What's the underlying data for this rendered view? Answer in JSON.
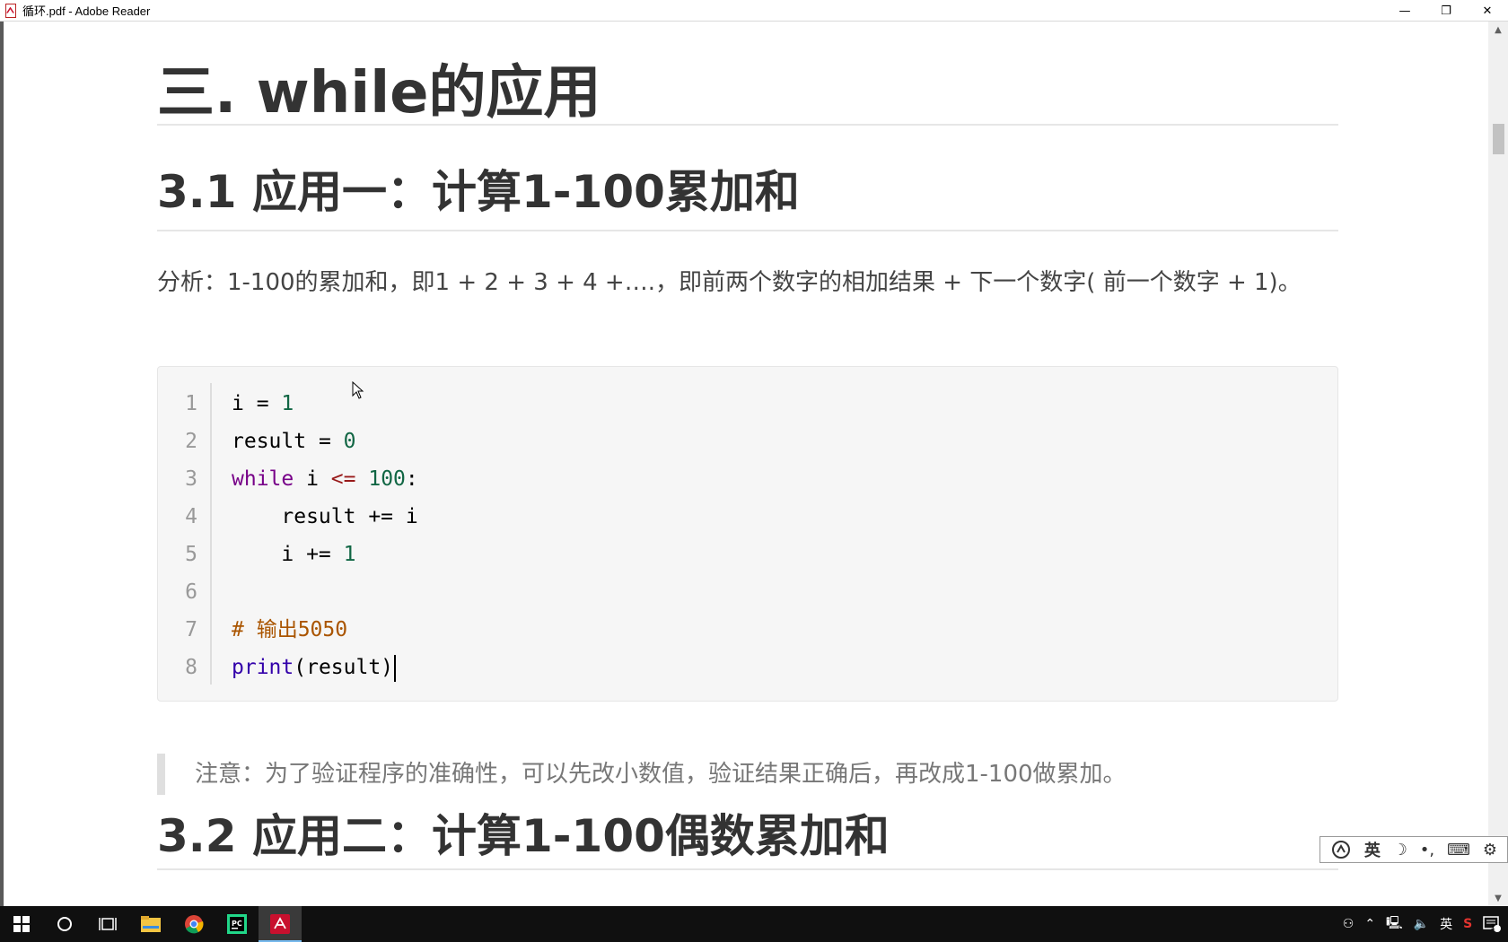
{
  "window": {
    "title": "循环.pdf - Adobe Reader",
    "controls": [
      "—",
      "❐",
      "✕"
    ]
  },
  "document": {
    "h1": "三. while的应用",
    "h2_1": "3.1 应用一：计算1-100累加和",
    "paragraph": "分析：1-100的累加和，即1 + 2 + 3 + 4 +….，即前两个数字的相加结果 + 下一个数字( 前一个数字 + 1)。",
    "code": {
      "line_numbers": [
        "1",
        "2",
        "3",
        "4",
        "5",
        "6",
        "7",
        "8"
      ],
      "lines": [
        [
          {
            "t": "i ",
            "c": ""
          },
          {
            "t": "=",
            "c": ""
          },
          {
            "t": " ",
            "c": ""
          },
          {
            "t": "1",
            "c": "num"
          }
        ],
        [
          {
            "t": "result ",
            "c": ""
          },
          {
            "t": "=",
            "c": ""
          },
          {
            "t": " ",
            "c": ""
          },
          {
            "t": "0",
            "c": "num"
          }
        ],
        [
          {
            "t": "while",
            "c": "kw"
          },
          {
            "t": " i ",
            "c": ""
          },
          {
            "t": "<=",
            "c": "op"
          },
          {
            "t": " ",
            "c": ""
          },
          {
            "t": "100",
            "c": "num"
          },
          {
            "t": ":",
            "c": ""
          }
        ],
        [
          {
            "t": "    result += i",
            "c": ""
          }
        ],
        [
          {
            "t": "    i += ",
            "c": ""
          },
          {
            "t": "1",
            "c": "num"
          }
        ],
        [
          {
            "t": "",
            "c": ""
          }
        ],
        [
          {
            "t": "# 输出5050",
            "c": "cm"
          }
        ],
        [
          {
            "t": "print",
            "c": "bi"
          },
          {
            "t": "(result)",
            "c": ""
          }
        ]
      ]
    },
    "note": "注意：为了验证程序的准确性，可以先改小数值，验证结果正确后，再改成1-100做累加。",
    "h2_2": "3.2 应用二：计算1-100偶数累加和"
  },
  "ime_toolbar": {
    "logo_icon": "sogou-logo-icon",
    "lang": "英",
    "items": [
      "moon-icon",
      "punctuation-icon",
      "keyboard-icon",
      "gear-icon"
    ]
  },
  "taskbar": {
    "apps": [
      "windows-start-icon",
      "cortana-search-icon",
      "task-view-icon",
      "file-explorer-icon",
      "chrome-icon",
      "pycharm-icon",
      "adobe-reader-icon"
    ],
    "tray_lang": "英",
    "notification_count": "1"
  },
  "colors": {
    "keyword": "#770088",
    "number": "#116644",
    "operator": "#981a1a",
    "comment": "#aa5500",
    "builtin": "#3300aa",
    "heading": "#333333"
  }
}
